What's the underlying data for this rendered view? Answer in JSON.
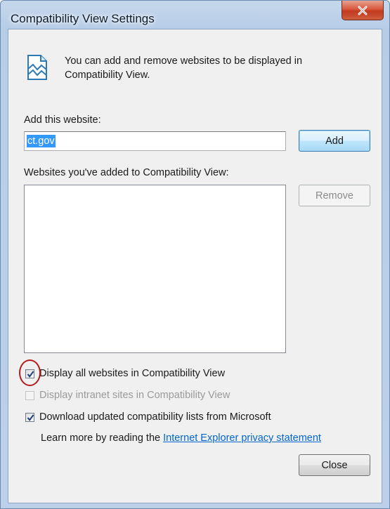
{
  "window": {
    "title": "Compatibility View Settings",
    "close_icon": "close-x-icon"
  },
  "info": {
    "icon": "compatibility-view-broken-page-icon",
    "text": "You can add and remove websites to be displayed in Compatibility View."
  },
  "add_website": {
    "label": "Add this website:",
    "value": "ct.gov",
    "button_label": "Add"
  },
  "websites_list": {
    "label": "Websites you've added to Compatibility View:",
    "items": [],
    "remove_label": "Remove"
  },
  "options": {
    "display_all": {
      "label": "Display all websites in Compatibility View",
      "checked": true,
      "enabled": true
    },
    "display_intranet": {
      "label": "Display intranet sites in Compatibility View",
      "checked": false,
      "enabled": false
    },
    "download_lists": {
      "label": "Download updated compatibility lists from Microsoft",
      "checked": true,
      "enabled": true
    }
  },
  "privacy": {
    "prefix": "Learn more by reading the",
    "link_text": "Internet Explorer privacy statement"
  },
  "footer": {
    "close_label": "Close"
  },
  "colors": {
    "accent": "#3399ff",
    "link": "#0066cc",
    "annotation_circle": "#b31b1b"
  }
}
